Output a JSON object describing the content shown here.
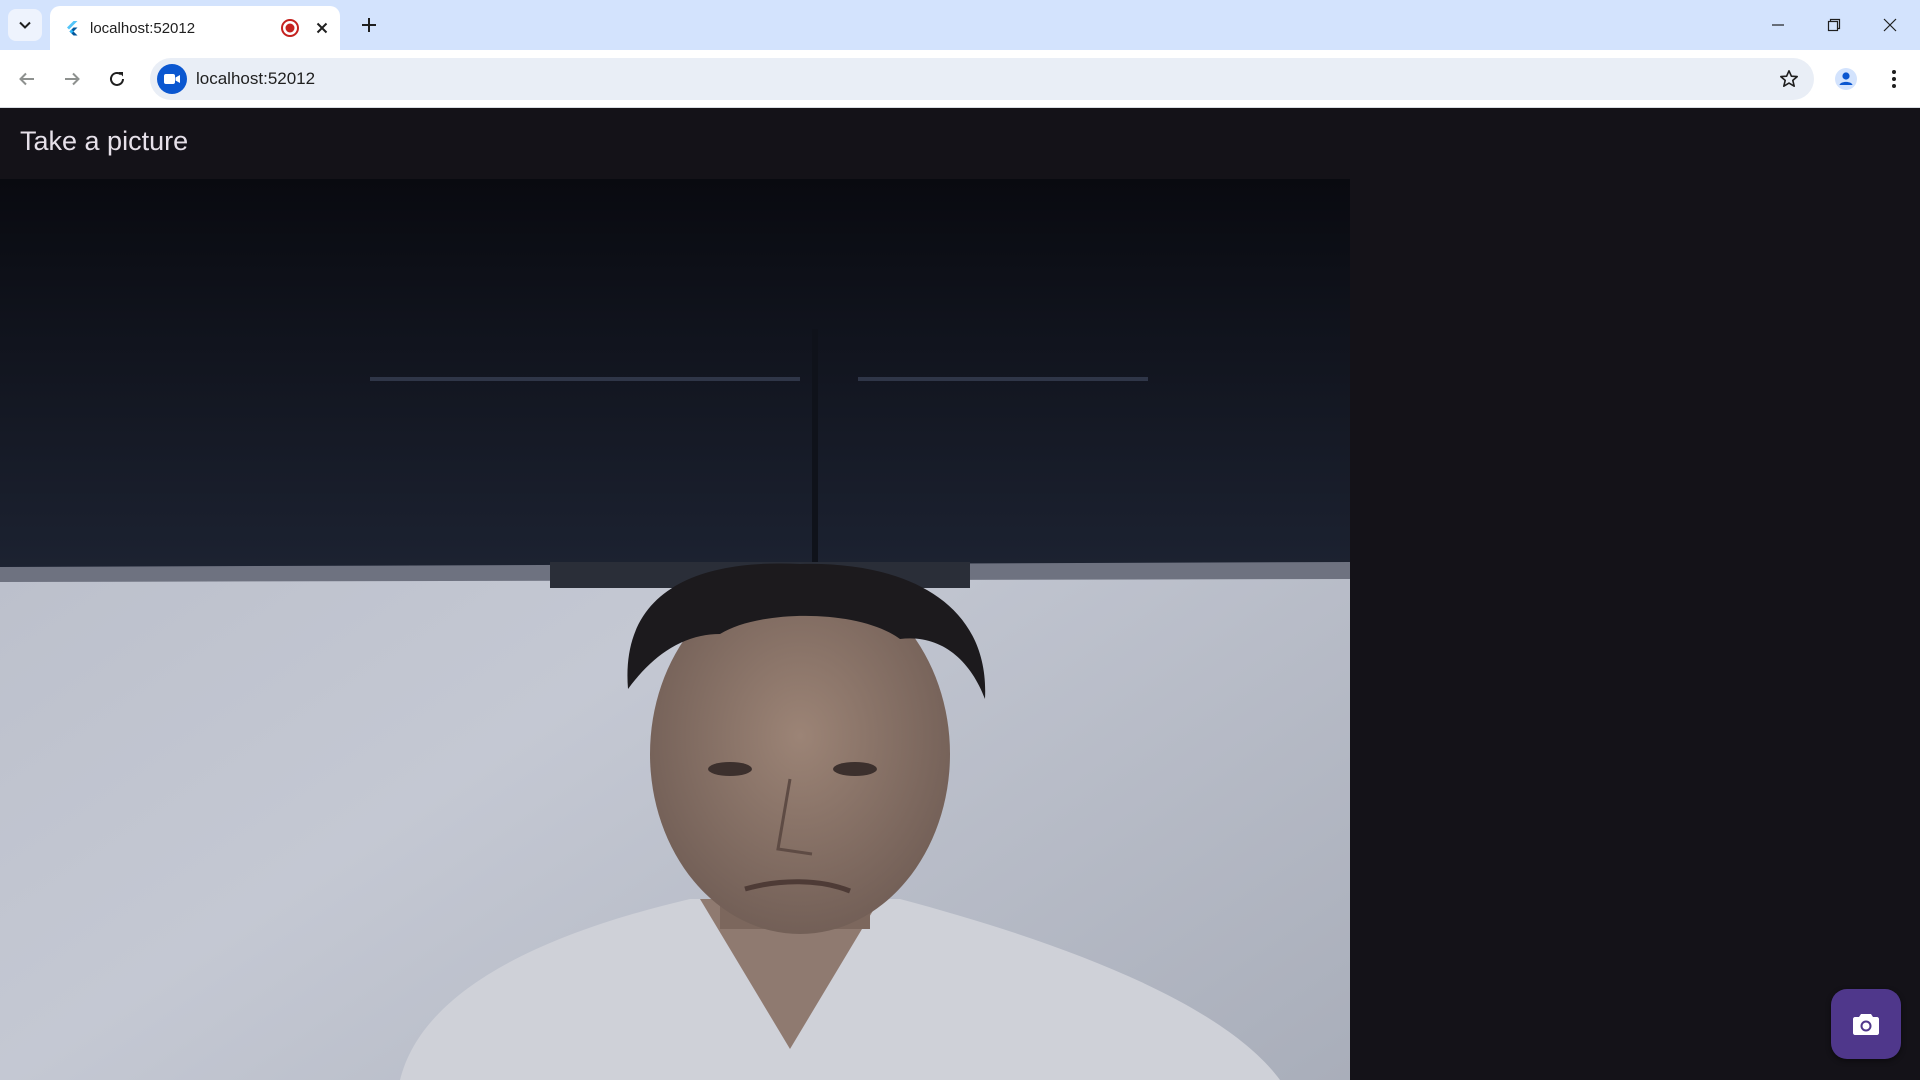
{
  "browser": {
    "tab": {
      "title": "localhost:52012"
    },
    "address_bar": {
      "url": "localhost:52012"
    }
  },
  "app": {
    "title": "Take a picture",
    "fab_icon": "camera-icon"
  },
  "colors": {
    "tabstrip": "#d3e3fd",
    "app_background": "#141218",
    "fab": "#4f378b",
    "recording": "#c5221f",
    "accent": "#0b57d0"
  }
}
